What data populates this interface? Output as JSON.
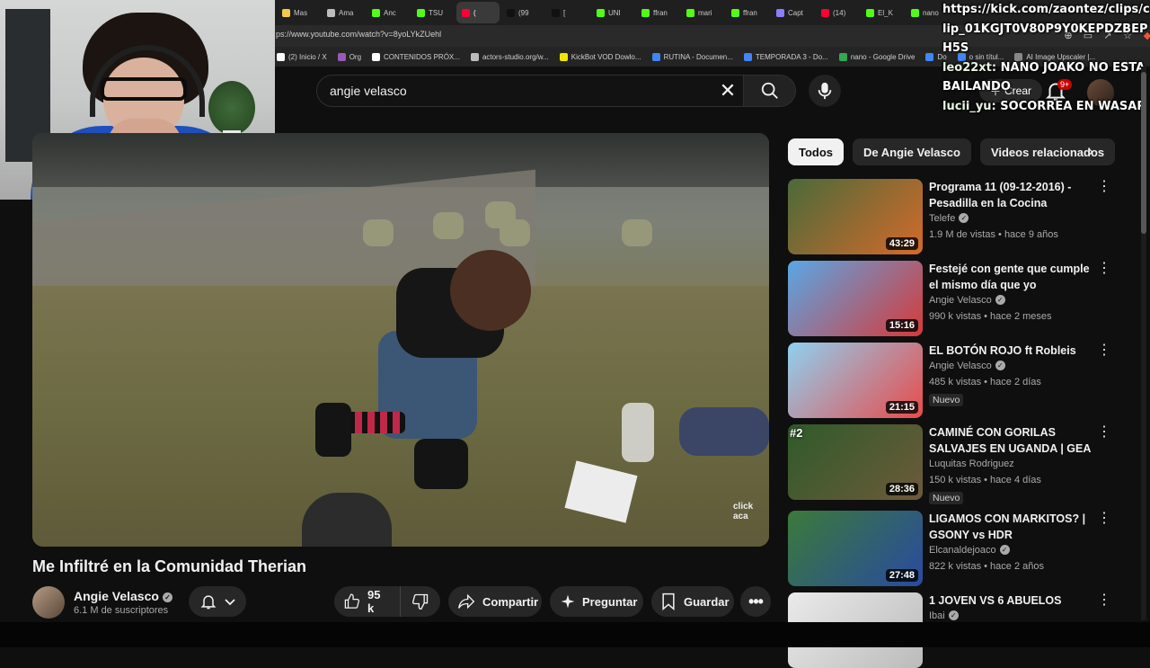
{
  "browser": {
    "tabs": [
      {
        "label": "Mas",
        "color": "#f2c94c"
      },
      {
        "label": "Ama",
        "color": "#bdbdbd"
      },
      {
        "label": "Anc",
        "color": "#53fc18"
      },
      {
        "label": "TSU",
        "color": "#53fc18"
      },
      {
        "label": "(",
        "color": "#ff0033",
        "active": true
      },
      {
        "label": "(99",
        "color": "#111111"
      },
      {
        "label": "[",
        "color": "#111111"
      },
      {
        "label": "UNI",
        "color": "#53fc18"
      },
      {
        "label": "ffran",
        "color": "#53fc18"
      },
      {
        "label": "mari",
        "color": "#53fc18"
      },
      {
        "label": "ffran",
        "color": "#53fc18"
      },
      {
        "label": "Capt",
        "color": "#8a7fff"
      },
      {
        "label": "(14)",
        "color": "#ff0033"
      },
      {
        "label": "El_K",
        "color": "#53fc18"
      },
      {
        "label": "nano",
        "color": "#53fc18"
      }
    ],
    "url": "ps://www.youtube.com/watch?v=8yoLYkZUehl",
    "bookmarks": [
      {
        "label": "(2) Inicio / X",
        "color": "#ffffff"
      },
      {
        "label": "Org",
        "color": "#9b59b6"
      },
      {
        "label": "CONTENIDOS PRÓX...",
        "color": "#ffffff"
      },
      {
        "label": "actors-studio.org/w...",
        "color": "#bbbbbb"
      },
      {
        "label": "KickBot VOD Dowlo...",
        "color": "#f2e600"
      },
      {
        "label": "RUTINA - Documen...",
        "color": "#4285f4"
      },
      {
        "label": "TEMPORADA 3 - Do...",
        "color": "#4285f4"
      },
      {
        "label": "nano - Google Drive",
        "color": "#34a853"
      },
      {
        "label": "Do",
        "color": "#4285f4"
      },
      {
        "label": "o sin títul...",
        "color": "#4285f4"
      },
      {
        "label": "AI Image Upscaler |...",
        "color": "#888888"
      }
    ]
  },
  "search": {
    "query": "angie velasco",
    "clear": "✕"
  },
  "header": {
    "create_label": "Crear",
    "notif_count": "9+"
  },
  "video": {
    "title": "Me Infiltré en la Comunidad Therian",
    "watermark": "click aca",
    "channel": "Angie Velasco",
    "subscribers": "6.1 M de suscriptores",
    "likes": "95 k",
    "share_label": "Compartir",
    "ask_label": "Preguntar",
    "save_label": "Guardar"
  },
  "chips": [
    "Todos",
    "De Angie Velasco",
    "Videos relacionados"
  ],
  "recommendations": [
    {
      "title": "Programa 11 (09-12-2016) - Pesadilla en la Cocina",
      "channel": "Telefe",
      "verified": true,
      "meta": "1.9 M de vistas • hace 9 años",
      "duration": "43:29",
      "badge": "",
      "rank": "",
      "thumb": [
        "#4a6a3a",
        "#d46a2a"
      ]
    },
    {
      "title": "Festejé con gente que cumple el mismo día que yo",
      "channel": "Angie Velasco",
      "verified": true,
      "meta": "990 k vistas • hace 2 meses",
      "duration": "15:16",
      "badge": "",
      "rank": "",
      "thumb": [
        "#59a7e6",
        "#d63a3a"
      ]
    },
    {
      "title": "EL BOTÓN ROJO ft Robleis",
      "channel": "Angie Velasco",
      "verified": true,
      "meta": "485 k vistas • hace 2 días",
      "duration": "21:15",
      "badge": "Nuevo",
      "rank": "",
      "thumb": [
        "#8fd0f0",
        "#e84b4b"
      ]
    },
    {
      "title": "CAMINÉ CON GORILAS SALVAJES EN UGANDA | GEA ...",
      "channel": "Luquitas Rodriguez",
      "verified": false,
      "meta": "150 k vistas • hace 4 días",
      "duration": "28:36",
      "badge": "Nuevo",
      "rank": "#2",
      "thumb": [
        "#2f5a2a",
        "#6d5a3a"
      ]
    },
    {
      "title": "LIGAMOS CON MARKITOS? | GSONY vs HDR",
      "channel": "Elcanaldejoaco",
      "verified": true,
      "meta": "822 k vistas • hace 2 años",
      "duration": "27:48",
      "badge": "",
      "rank": "",
      "thumb": [
        "#3a7a3a",
        "#2a4aa0"
      ]
    },
    {
      "title": "1 JOVEN VS 6 ABUELOS",
      "channel": "Ibai",
      "verified": true,
      "meta": "",
      "duration": "",
      "badge": "",
      "rank": "",
      "thumb": [
        "#eaeaea",
        "#bbbbbb"
      ]
    }
  ],
  "chat": [
    {
      "text": "https://kick.com/zaontez/clips/clip_01KGJT0V80P9Y0KEPDZBEPH5S"
    },
    {
      "user": "leo22xt:",
      "text": "NANO JOAKO NO ESTA BAILANDO"
    },
    {
      "user": "lucii_yu:",
      "text": "SOCORREA EN WASAP"
    }
  ],
  "colors": {
    "background": "#0f0f0f",
    "surface": "#272727",
    "text": "#f1f1f1",
    "muted": "#aaaaaa",
    "brand": "#ff0033"
  }
}
